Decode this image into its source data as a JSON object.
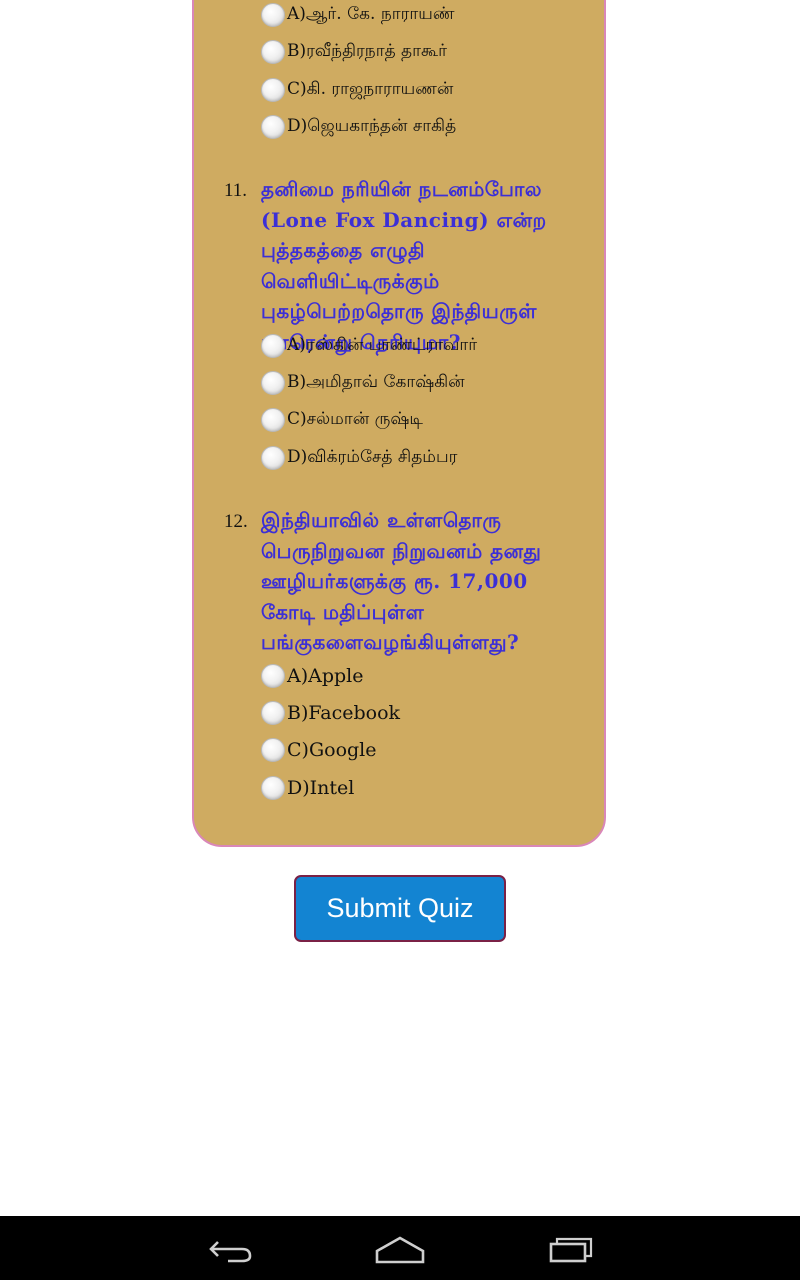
{
  "q10": {
    "options": [
      "A)ஆர். கே. நாராயண்",
      "B)ரவீந்திரநாத் தாகூர்",
      "C)கி. ராஜநாராயணன்",
      "D)ஜெயகாந்தன் சாகித்"
    ]
  },
  "q11": {
    "number": "11.",
    "question": "தனிமை நரியின் நடனம்போல (Lone Fox Dancing) என்ற புத்தகத்தை எழுதி வெளியிட்டிருக்கும் புகழ்பெற்றதொரு இந்தியருள் யாரென்று தெரியுமா?",
    "options": [
      "A)ரஸ்கின் பாண்ட்ராவார்",
      "B)அமிதாவ் கோஷ்கின்",
      "C)சல்மான் ருஷ்டி",
      "D)விக்ரம்சேத் சிதம்பர"
    ]
  },
  "q12": {
    "number": "12.",
    "question": "இந்தியாவில் உள்ளதொரு பெருநிறுவன நிறுவனம் தனது ஊழியர்களுக்கு ரூ. 17,000 கோடி மதிப்புள்ள பங்குகளைவழங்கியுள்ளது?",
    "options": [
      "A)Apple",
      "B)Facebook",
      "C)Google",
      "D)Intel"
    ]
  },
  "submit_label": "Submit Quiz",
  "nav": {
    "back": "back-icon",
    "home": "home-icon",
    "recents": "recents-icon"
  },
  "colors": {
    "card": "#cfab61",
    "card_border": "#d987b8",
    "question": "#3c2fd6",
    "button": "#1384d2",
    "button_border": "#7a2146"
  }
}
